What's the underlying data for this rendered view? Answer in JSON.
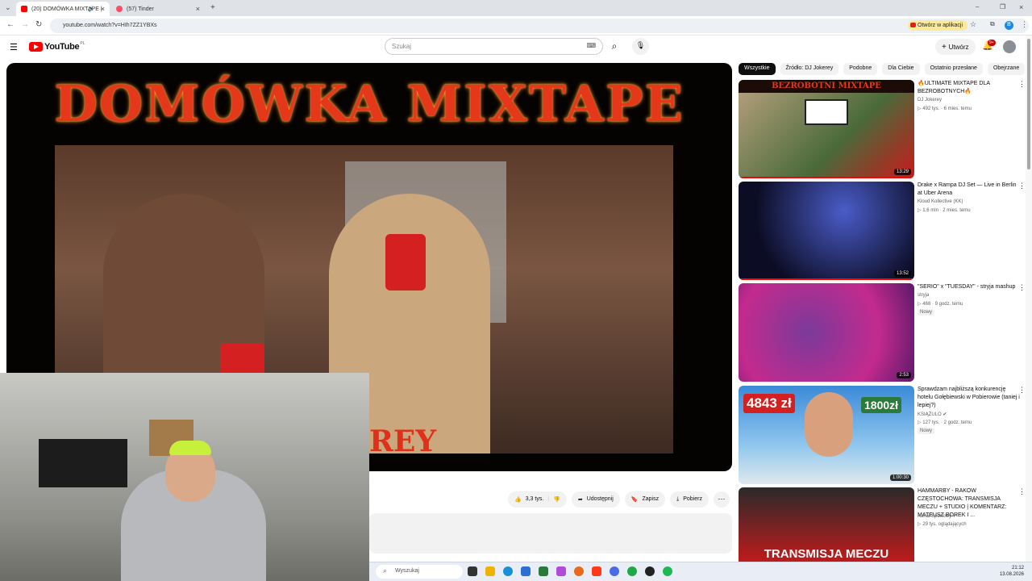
{
  "browser": {
    "tabs": [
      {
        "label": "(20) DOMÓWKA MIXTAPE |"
      },
      {
        "label": "(57) Tinder"
      }
    ],
    "url": "youtube.com/watch?v=HIh7ZZ1YBXs",
    "open_in_app": "Otwórz w aplikacji",
    "profile_initial": "B"
  },
  "youtube": {
    "logo_text": "YouTube",
    "region": "PL",
    "search_placeholder": "Szukaj",
    "create_label": "Utwórz",
    "notif_count": "9+"
  },
  "video": {
    "overlay_title": "DOMÓWKA MIXTAPE",
    "overlay_fragment": "REY"
  },
  "actions": {
    "likes": "3,3 tys.",
    "share": "Udostępnij",
    "save": "Zapisz",
    "download": "Pobierz"
  },
  "chips": [
    "Wszystkie",
    "Źródło: DJ Jokerey",
    "Podobne",
    "Dla Ciebie",
    "Ostatnio przesłane",
    "Obejrzane"
  ],
  "recommendations": [
    {
      "title": "🔥ULTIMATE MIXTAPE DLA BEZROBOTNYCH🔥",
      "channel": "DJ Jokerey",
      "meta": "▷ 492 tys. · 6 mies. temu",
      "duration": "13:29",
      "thumb_text": "BEZROBOTNI MIXTAPE",
      "new": ""
    },
    {
      "title": "Drake x Rampa DJ Set — Live in Berlin at Uber Arena",
      "channel": "Kloud Kollective (KK)",
      "meta": "▷ 1,6 mln · 2 mies. temu",
      "duration": "13:52",
      "thumb_text": "",
      "new": ""
    },
    {
      "title": "\"SERIO\" x \"TUESDAY\" - stryja mashup",
      "channel": "stryja",
      "meta": "▷ 468 · 9 godz. temu",
      "duration": "2:53",
      "thumb_text": "",
      "new": "Nowy"
    },
    {
      "title": "Sprawdzam najbliższą konkurencję hotelu Gołębiewski w Pobierowie (taniej i lepiej?)",
      "channel": "KSIĄŻULO ✔",
      "meta": "▷ 127 tys. · 2 godz. temu",
      "duration": "1:00:30",
      "thumb_text": "4843 zł",
      "thumb_text2": "1800zł",
      "new": "Nowy"
    },
    {
      "title": "HAMMARBY - RAKÓW CZĘSTOCHOWA: TRANSMISJA MECZU + STUDIO | KOMENTARZ: MATEUSZ BOREK I ...",
      "channel": "Kanał Sportowy ✔",
      "meta": "▷ 29 tys. oglądających",
      "duration": "",
      "thumb_text": "TRANSMISJA MECZU",
      "new": ""
    }
  ],
  "taskbar": {
    "search_placeholder": "Wyszukaj",
    "time": "21:12",
    "date": "13.08.2026"
  },
  "colors": {
    "yt_red": "#ff0000",
    "title_fire": "#e5371a",
    "chip_active": "#0f0f0f"
  }
}
